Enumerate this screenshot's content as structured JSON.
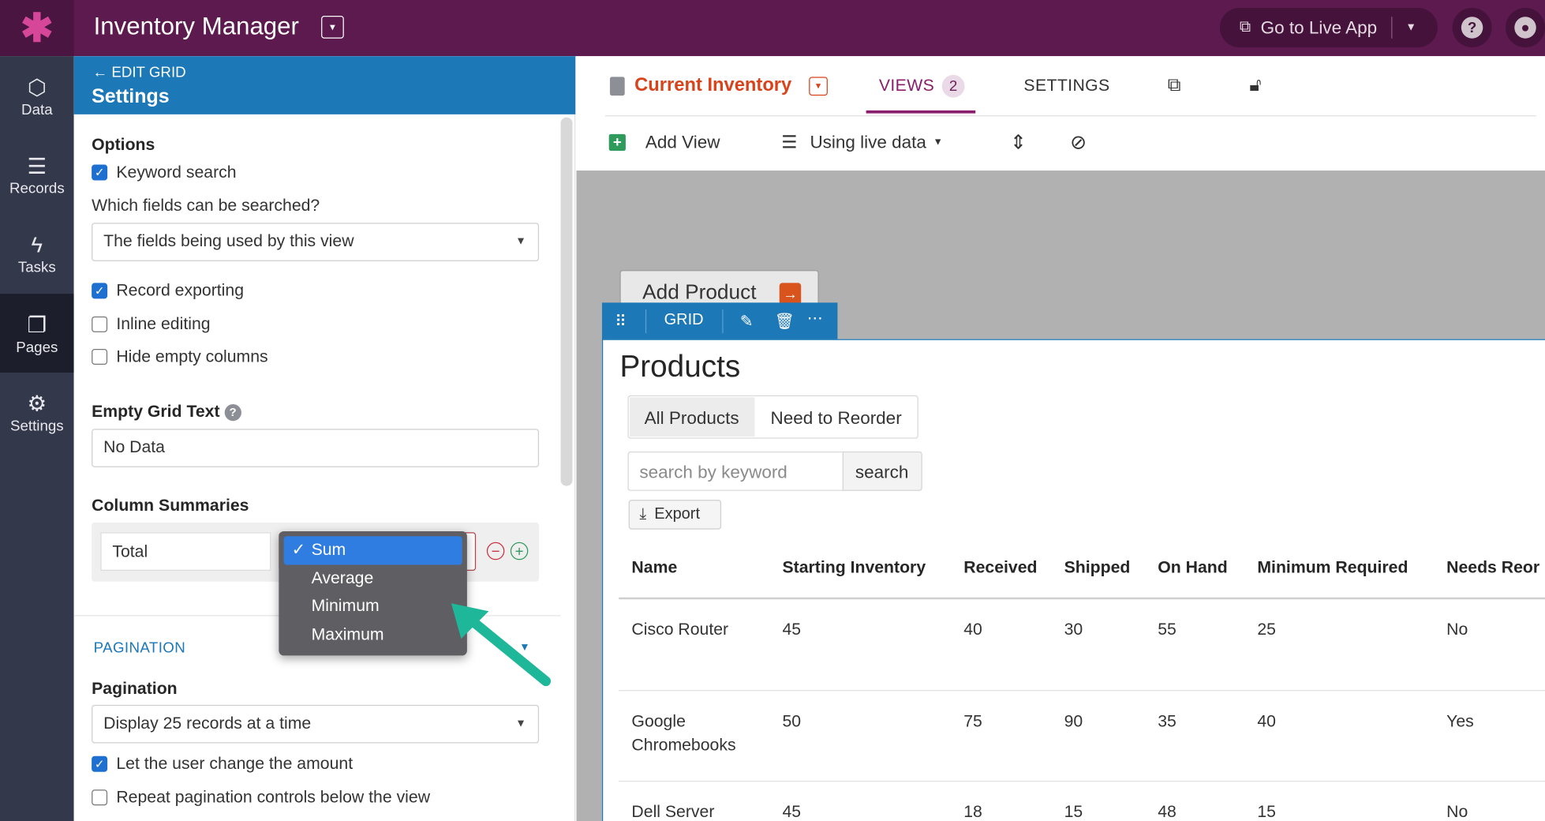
{
  "topbar": {
    "app_title": "Inventory Manager",
    "live_app_label": "Go to Live App"
  },
  "nav": {
    "items": [
      {
        "label": "Data",
        "icon": "cubes-icon"
      },
      {
        "label": "Records",
        "icon": "database-icon"
      },
      {
        "label": "Tasks",
        "icon": "lightning-icon"
      },
      {
        "label": "Pages",
        "icon": "pages-icon",
        "active": true
      },
      {
        "label": "Settings",
        "icon": "gear-icon"
      }
    ]
  },
  "panel": {
    "back_label": "EDIT GRID",
    "title": "Settings",
    "options_heading": "Options",
    "keyword_search": {
      "label": "Keyword search",
      "checked": true
    },
    "search_fields_label": "Which fields can be searched?",
    "search_fields_value": "The fields being used by this view",
    "record_exporting": {
      "label": "Record exporting",
      "checked": true
    },
    "inline_editing": {
      "label": "Inline editing",
      "checked": false
    },
    "hide_empty_columns": {
      "label": "Hide empty columns",
      "checked": false
    },
    "empty_grid_text_heading": "Empty Grid Text",
    "empty_grid_text_value": "No Data",
    "column_summaries_heading": "Column Summaries",
    "summary_name_value": "Total",
    "summary_options": [
      "Sum",
      "Average",
      "Minimum",
      "Maximum"
    ],
    "summary_selected": "Sum",
    "pagination_section": "PAGINATION",
    "pagination_heading": "Pagination",
    "pagination_value": "Display 25 records at a time",
    "let_user_change": {
      "label": "Let the user change the amount",
      "checked": true
    },
    "repeat_controls": {
      "label": "Repeat pagination controls below the view",
      "checked": false
    }
  },
  "main": {
    "page_name": "Current Inventory",
    "tabs": {
      "views": "VIEWS",
      "views_count": "2",
      "settings": "SETTINGS"
    },
    "toolbar": {
      "add_view": "Add View",
      "live_data": "Using live data"
    },
    "add_product": "Add Product",
    "grid_label": "GRID",
    "view_title": "Products",
    "filters": [
      "All Products",
      "Need to Reorder"
    ],
    "search_placeholder": "search by keyword",
    "search_button": "search",
    "export_button": "Export",
    "columns": [
      "Name",
      "Starting Inventory",
      "Received",
      "Shipped",
      "On Hand",
      "Minimum Required",
      "Needs Reor"
    ],
    "rows": [
      {
        "name": "Cisco Router",
        "name2": "",
        "start": "45",
        "received": "40",
        "shipped": "30",
        "on_hand": "55",
        "min": "25",
        "needs": "No"
      },
      {
        "name": "Google",
        "name2": "Chromebooks",
        "start": "50",
        "received": "75",
        "shipped": "90",
        "on_hand": "35",
        "min": "40",
        "needs": "Yes"
      },
      {
        "name": "Dell Server",
        "name2": "",
        "start": "45",
        "received": "18",
        "shipped": "15",
        "on_hand": "48",
        "min": "15",
        "needs": "No"
      }
    ]
  },
  "colors": {
    "topbar": "#5c1a4f",
    "panel_header": "#1d78b8",
    "accent_orange": "#d9431b",
    "views_purple": "#8a1d6c",
    "arrow_teal": "#1fb79a"
  }
}
